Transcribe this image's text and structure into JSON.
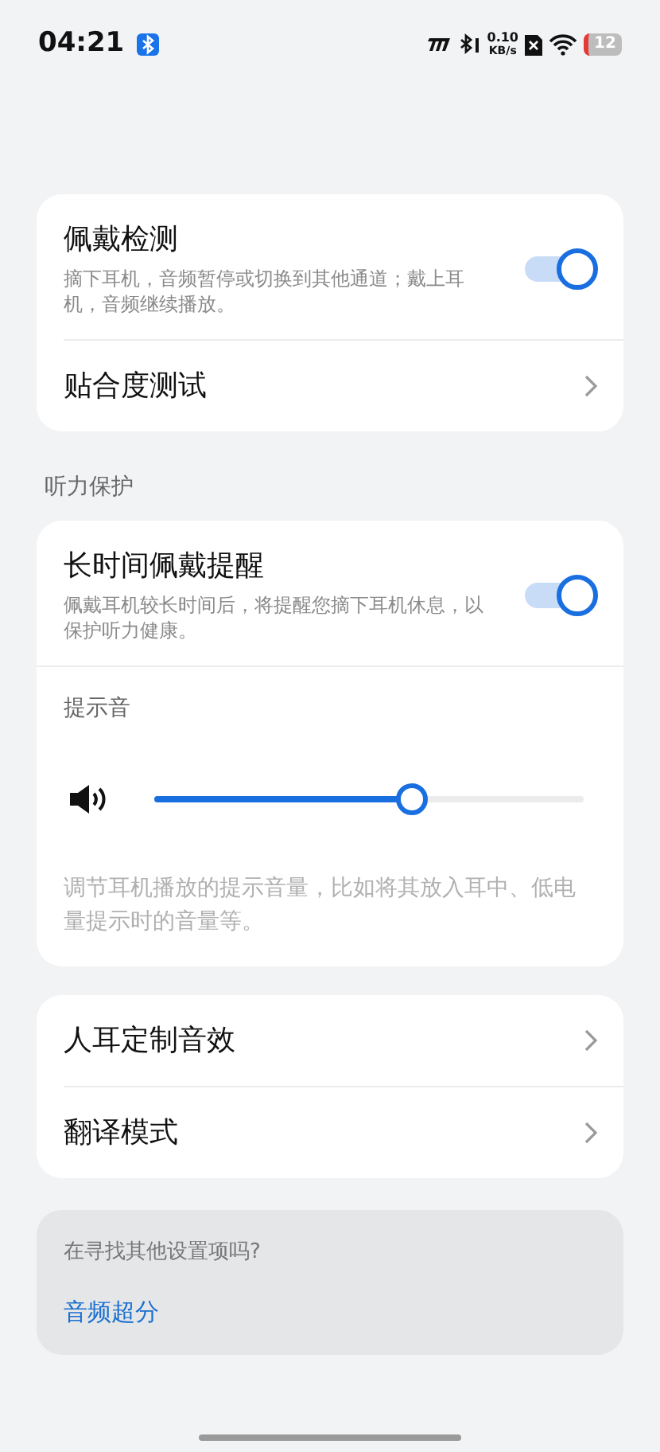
{
  "status_bar": {
    "time": "04:21",
    "network_speed": "0.10",
    "network_unit": "KB/s",
    "battery": "12"
  },
  "card_1": [
    {
      "kind": "toggle",
      "title": "佩戴检测",
      "description": "摘下耳机，音频暂停或切换到其他通道；戴上耳机，音频继续播放。",
      "on": true
    },
    {
      "kind": "link",
      "title": "贴合度测试"
    }
  ],
  "section_label": "听力保护",
  "card_2": {
    "toggle": {
      "title": "长时间佩戴提醒",
      "description": "佩戴耳机较长时间后，将提醒您摘下耳机休息，以保护听力健康。",
      "on": true
    },
    "volume": {
      "label": "提示音",
      "level": 0.6,
      "note": "调节耳机播放的提示音量，比如将其放入耳中、低电量提示时的音量等。"
    }
  },
  "card_3": [
    {
      "kind": "link",
      "title": "人耳定制音效"
    },
    {
      "kind": "link",
      "title": "翻译模式"
    }
  ],
  "suggestion": {
    "question": "在寻找其他设置项吗?",
    "link": "音频超分"
  }
}
